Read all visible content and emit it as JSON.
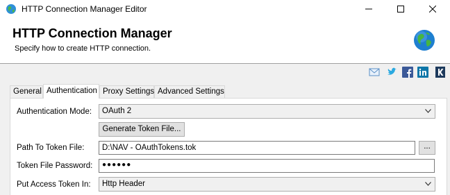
{
  "window": {
    "title": "HTTP Connection Manager Editor"
  },
  "header": {
    "title": "HTTP Connection Manager",
    "subtitle": "Specify how to create HTTP connection."
  },
  "social_icons": [
    "mail-icon",
    "twitter-icon",
    "facebook-icon",
    "linkedin-icon",
    "kingswaysoft-icon"
  ],
  "tabs": [
    {
      "label": "General",
      "active": false
    },
    {
      "label": "Authentication",
      "active": true
    },
    {
      "label": "Proxy Settings",
      "active": false
    },
    {
      "label": "Advanced Settings",
      "active": false
    }
  ],
  "form": {
    "auth_mode_label": "Authentication Mode:",
    "auth_mode_value": "OAuth 2",
    "generate_button": "Generate Token File...",
    "path_label": "Path To Token File:",
    "path_value": "D:\\NAV - OAuthTokens.tok",
    "browse_button": "...",
    "password_label": "Token File Password:",
    "password_value": "●●●●●●",
    "put_token_label": "Put Access Token In:",
    "put_token_value": "Http Header"
  },
  "colors": {
    "tab_border": "#d9d9d9",
    "button_face": "#e1e1e1",
    "dialog_bg": "#f0f0f0"
  }
}
